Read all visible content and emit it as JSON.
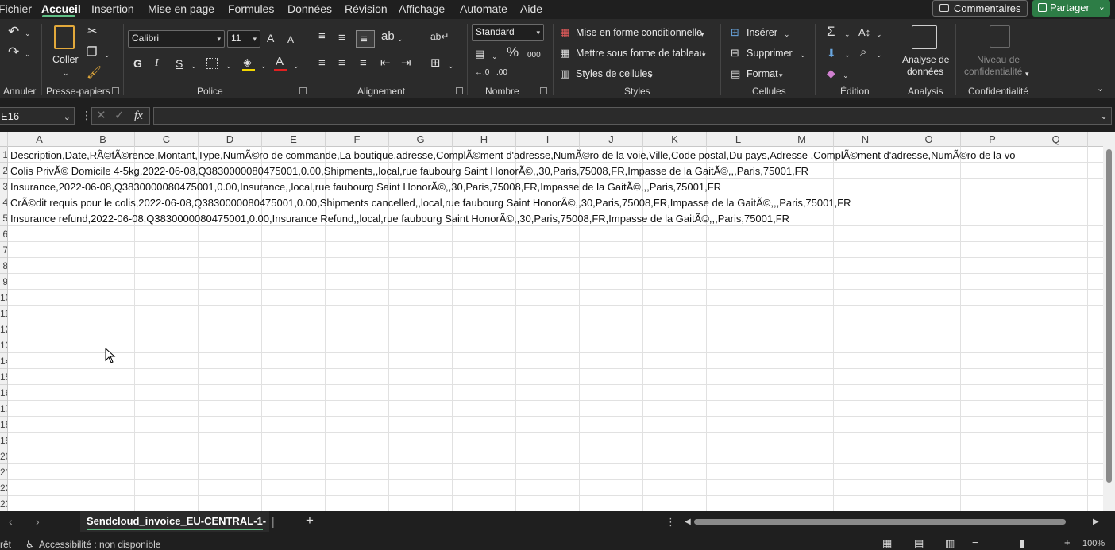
{
  "menu": {
    "tabs": [
      "Fichier",
      "Accueil",
      "Insertion",
      "Mise en page",
      "Formules",
      "Données",
      "Révision",
      "Affichage",
      "Automate",
      "Aide"
    ],
    "comments_label": "Commentaires",
    "share_label": "Partager"
  },
  "ribbon": {
    "undo_group_label": "Annuler",
    "clipboard": {
      "paste_label": "Coller",
      "group_label": "Presse-papiers"
    },
    "font": {
      "name": "Calibri",
      "size": "11",
      "bold": "G",
      "italic": "I",
      "underline": "S",
      "grow": "A",
      "shrink": "A",
      "group_label": "Police",
      "fill_color": "#f2d600",
      "font_color": "#e02020"
    },
    "alignment": {
      "group_label": "Alignement"
    },
    "number": {
      "format": "Standard",
      "percent": "%",
      "thousands": "000",
      "group_label": "Nombre"
    },
    "styles": {
      "conditional": "Mise en forme conditionnelle",
      "table": "Mettre sous forme de tableau",
      "cell_styles": "Styles de cellules",
      "group_label": "Styles"
    },
    "cells": {
      "insert": "Insérer",
      "delete": "Supprimer",
      "format": "Format",
      "group_label": "Cellules"
    },
    "editing": {
      "group_label": "Édition"
    },
    "analysis": {
      "line1": "Analyse de",
      "line2": "données",
      "group_label": "Analysis"
    },
    "sensitivity": {
      "line1": "Niveau de",
      "line2": "confidentialité",
      "group_label": "Confidentialité"
    }
  },
  "formula_bar": {
    "cell_ref": "E16",
    "fx": "fx",
    "value": ""
  },
  "grid": {
    "columns": [
      "A",
      "B",
      "C",
      "D",
      "E",
      "F",
      "G",
      "H",
      "I",
      "J",
      "K",
      "L",
      "M",
      "N",
      "O",
      "P",
      "Q"
    ],
    "row_labels": [
      "1",
      "2",
      "3",
      "4",
      "5",
      "6",
      "7",
      "8",
      "9",
      "10",
      "11",
      "12",
      "13",
      "14",
      "15",
      "16",
      "17",
      "18",
      "19",
      "20",
      "21",
      "22",
      "23"
    ],
    "rows": [
      "Description,Date,RÃ©fÃ©rence,Montant,Type,NumÃ©ro de commande,La boutique,adresse,ComplÃ©ment d'adresse,NumÃ©ro de la voie,Ville,Code postal,Du pays,Adresse ,ComplÃ©ment d'adresse,NumÃ©ro de la vo",
      "Colis PrivÃ© Domicile 4-5kg,2022-06-08,Q3830000080475001,0.00,Shipments,,local,rue faubourg Saint HonorÃ©,,30,Paris,75008,FR,Impasse de la GaitÃ©,,,Paris,75001,FR",
      "Insurance,2022-06-08,Q3830000080475001,0.00,Insurance,,local,rue faubourg Saint HonorÃ©,,30,Paris,75008,FR,Impasse de la GaitÃ©,,,Paris,75001,FR",
      "CrÃ©dit requis pour le colis,2022-06-08,Q3830000080475001,0.00,Shipments cancelled,,local,rue faubourg Saint HonorÃ©,,30,Paris,75008,FR,Impasse de la GaitÃ©,,,Paris,75001,FR",
      "Insurance refund,2022-06-08,Q3830000080475001,0.00,Insurance Refund,,local,rue faubourg Saint HonorÃ©,,30,Paris,75008,FR,Impasse de la GaitÃ©,,,Paris,75001,FR"
    ]
  },
  "sheet_tabs": {
    "active": "Sendcloud_invoice_EU-CENTRAL-1-",
    "add": "+"
  },
  "status": {
    "ready": "rêt",
    "accessibility": "Accessibilité : non disponible",
    "zoom": "100%"
  }
}
